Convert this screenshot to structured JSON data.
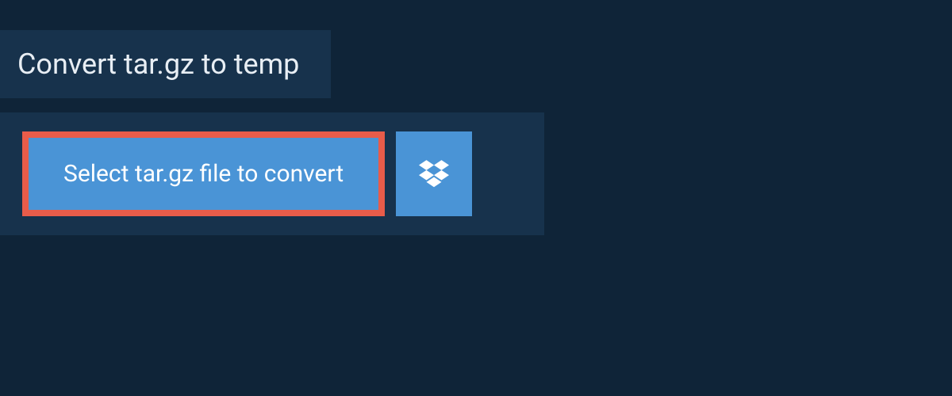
{
  "header": {
    "title": "Convert tar.gz to temp"
  },
  "upload": {
    "select_label": "Select tar.gz file to convert",
    "dropbox_icon": "dropbox-icon"
  },
  "colors": {
    "background": "#0f2438",
    "panel": "#17324c",
    "button": "#4a94d6",
    "highlight_border": "#e85c4a",
    "text_light": "#e8eef4",
    "text_white": "#ffffff"
  }
}
